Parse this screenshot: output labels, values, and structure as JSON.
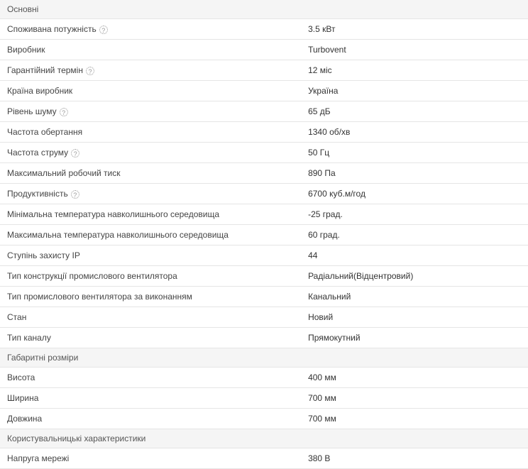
{
  "sections": [
    {
      "title": "Основні",
      "rows": [
        {
          "label": "Споживана потужність",
          "help": true,
          "value": "3.5 кВт"
        },
        {
          "label": "Виробник",
          "help": false,
          "value": "Turbovent"
        },
        {
          "label": "Гарантійний термін",
          "help": true,
          "value": "12 міс"
        },
        {
          "label": "Країна виробник",
          "help": false,
          "value": "Україна"
        },
        {
          "label": "Рівень шуму",
          "help": true,
          "value": "65 дБ"
        },
        {
          "label": "Частота обертання",
          "help": false,
          "value": "1340 об/хв"
        },
        {
          "label": "Частота струму",
          "help": true,
          "value": "50 Гц"
        },
        {
          "label": "Максимальний робочий тиск",
          "help": false,
          "value": "890 Па"
        },
        {
          "label": "Продуктивність",
          "help": true,
          "value": "6700 куб.м/год"
        },
        {
          "label": "Мінімальна температура навколишнього середовища",
          "help": false,
          "value": "-25 град."
        },
        {
          "label": "Максимальна температура навколишнього середовища",
          "help": false,
          "value": "60 град."
        },
        {
          "label": "Ступінь захисту IP",
          "help": false,
          "value": "44"
        },
        {
          "label": "Тип конструкції промислового вентилятора",
          "help": false,
          "value": "Радіальний(Відцентровий)"
        },
        {
          "label": "Тип промислового вентилятора за виконанням",
          "help": false,
          "value": "Канальний"
        },
        {
          "label": "Стан",
          "help": false,
          "value": "Новий"
        },
        {
          "label": "Тип каналу",
          "help": false,
          "value": "Прямокутний"
        }
      ]
    },
    {
      "title": "Габаритні розміри",
      "rows": [
        {
          "label": "Висота",
          "help": false,
          "value": "400 мм"
        },
        {
          "label": "Ширина",
          "help": false,
          "value": "700 мм"
        },
        {
          "label": "Довжина",
          "help": false,
          "value": "700 мм"
        }
      ]
    },
    {
      "title": "Користувальницькі характеристики",
      "rows": [
        {
          "label": "Напруга мережі",
          "help": false,
          "value": "380 В"
        }
      ]
    }
  ],
  "help_glyph": "?"
}
